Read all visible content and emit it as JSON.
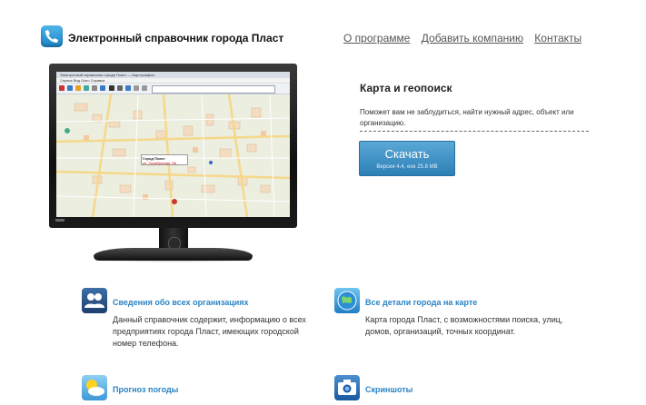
{
  "header": {
    "title": "Электронный справочник города Пласт",
    "nav": [
      "О программе",
      "Добавить компанию",
      "Контакты"
    ]
  },
  "screen_app": {
    "window_title": "Электронный справочник города Пласт — Картография",
    "menu": "Сервис  Вид  Окно  Справка",
    "popup_line1": "Город Пласт",
    "popup_line2": "ул. Октябрьская, 56"
  },
  "panel": {
    "title": "Карта и геопоиск",
    "description": "Поможет вам не заблудиться, найти нужный адрес, объект или организацию.",
    "download_label": "Скачать",
    "download_version": "Версия 4.4, exe 25.8 MB"
  },
  "features": [
    {
      "title": "Сведения обо всех организациях",
      "text": "Данный справочник содержит, информацию о всех предприятиях города Пласт, имеющих городской номер телефона.",
      "icon": "users-icon"
    },
    {
      "title": "Все детали города на карте",
      "text": "Карта города Пласт, с возможностями поиска, улиц, домов, организаций, точных координат.",
      "icon": "globe-icon"
    },
    {
      "title": "Прогноз погоды",
      "text": "",
      "icon": "weather-icon"
    },
    {
      "title": "Скриншоты",
      "text": "",
      "icon": "camera-icon"
    }
  ],
  "colors": {
    "link_blue": "#2a83c4",
    "button_top": "#5aa8d6",
    "button_bottom": "#2c7fb6"
  }
}
